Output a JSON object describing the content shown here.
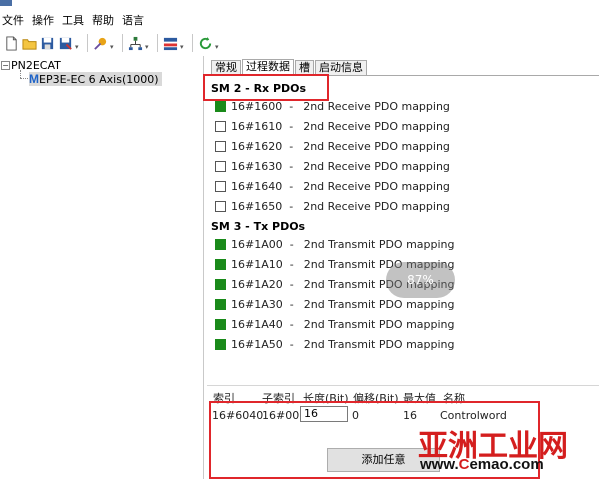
{
  "menu": [
    "文件",
    "操作",
    "工具",
    "帮助",
    "语言"
  ],
  "tree": {
    "root": "PN2ECAT",
    "child": "EP3E-EC 6 Axis(1000)",
    "child_logo": "M"
  },
  "tabs": [
    "常规",
    "过程数据",
    "槽",
    "启动信息"
  ],
  "active_tab": "过程数据",
  "sm2": {
    "title": "SM 2 - Rx PDOs",
    "rows": [
      {
        "id": "16#1600",
        "sep": "-",
        "name": "2nd Receive PDO mapping",
        "checked": true
      },
      {
        "id": "16#1610",
        "sep": "-",
        "name": "2nd Receive PDO mapping",
        "checked": false
      },
      {
        "id": "16#1620",
        "sep": "-",
        "name": "2nd Receive PDO mapping",
        "checked": false
      },
      {
        "id": "16#1630",
        "sep": "-",
        "name": "2nd Receive PDO mapping",
        "checked": false
      },
      {
        "id": "16#1640",
        "sep": "-",
        "name": "2nd Receive PDO mapping",
        "checked": false
      },
      {
        "id": "16#1650",
        "sep": "-",
        "name": "2nd Receive PDO mapping",
        "checked": false
      }
    ]
  },
  "sm3": {
    "title": "SM 3 - Tx PDOs",
    "rows": [
      {
        "id": "16#1A00",
        "sep": "-",
        "name": "2nd Transmit PDO mapping",
        "checked": true
      },
      {
        "id": "16#1A10",
        "sep": "-",
        "name": "2nd Transmit PDO mapping",
        "checked": true
      },
      {
        "id": "16#1A20",
        "sep": "-",
        "name": "2nd Transmit PDO mapping",
        "checked": true
      },
      {
        "id": "16#1A30",
        "sep": "-",
        "name": "2nd Transmit PDO mapping",
        "checked": true
      },
      {
        "id": "16#1A40",
        "sep": "-",
        "name": "2nd Transmit PDO mapping",
        "checked": true
      },
      {
        "id": "16#1A50",
        "sep": "-",
        "name": "2nd Transmit PDO mapping",
        "checked": true
      }
    ]
  },
  "grid": {
    "headers": {
      "index": "索引",
      "subindex": "子索引",
      "length": "长度(Bit)",
      "offset": "偏移(Bit)",
      "max": "最大值",
      "name": "名称"
    },
    "row": {
      "index": "16#6040",
      "subindex": "16#00",
      "length": "16",
      "offset": "0",
      "max": "16",
      "name": "Controlword"
    }
  },
  "add_button": "添加任意",
  "overlay": "87%",
  "watermark": {
    "cn": "亚洲工业网",
    "url_prefix": "www.",
    "url_c": "C",
    "url_rest": "emao.com"
  },
  "colors": {
    "checked": "#1a8a1a",
    "highlight_box": "#e0262b"
  }
}
